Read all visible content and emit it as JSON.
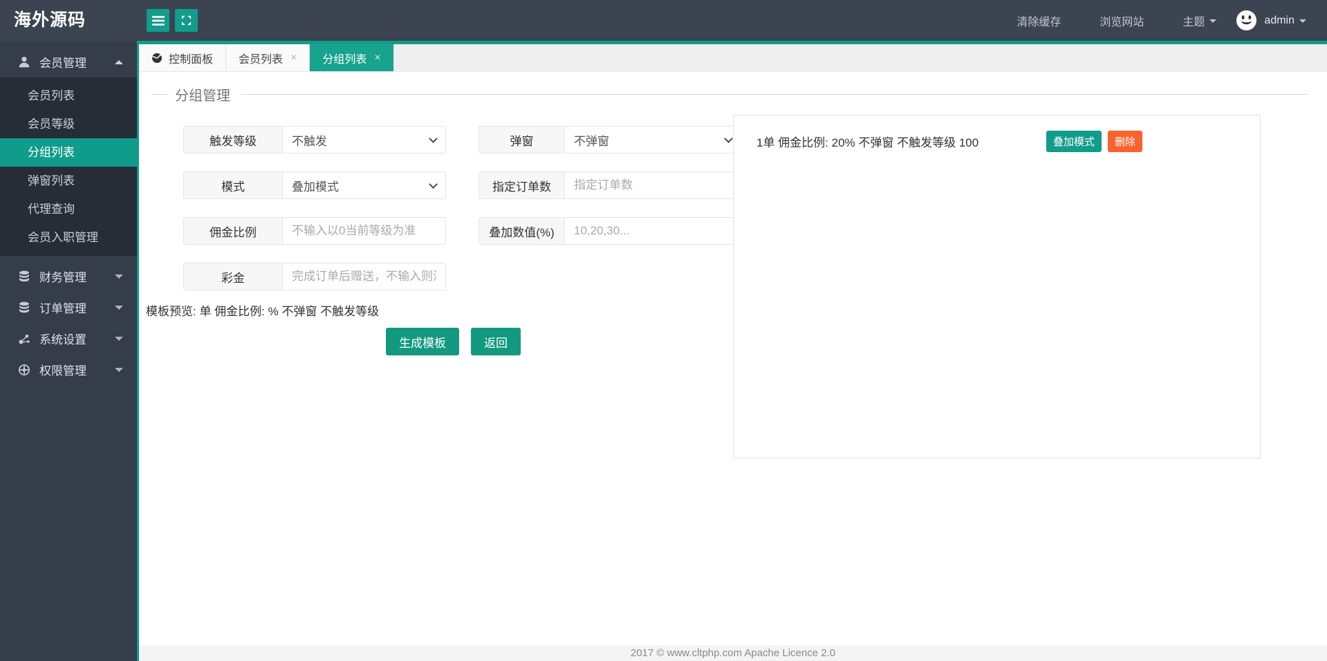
{
  "app": {
    "logo": "海外源码"
  },
  "header": {
    "clear_cache": "清除缓存",
    "browse_site": "浏览网站",
    "theme": "主题",
    "user": "admin"
  },
  "sidebar": {
    "groups": [
      {
        "label": "会员管理",
        "icon": "user-icon",
        "expanded": true,
        "children": [
          {
            "label": "会员列表"
          },
          {
            "label": "会员等级"
          },
          {
            "label": "分组列表",
            "active": true
          },
          {
            "label": "弹窗列表"
          },
          {
            "label": "代理查询"
          },
          {
            "label": "会员入职管理"
          }
        ]
      },
      {
        "label": "财务管理",
        "icon": "database-icon"
      },
      {
        "label": "订单管理",
        "icon": "database-icon"
      },
      {
        "label": "系统设置",
        "icon": "nodes-icon"
      },
      {
        "label": "权限管理",
        "icon": "globe-icon"
      }
    ]
  },
  "tabs": [
    {
      "label": "控制面板",
      "icon": "dashboard-icon",
      "closable": false
    },
    {
      "label": "会员列表",
      "closable": true,
      "close": "×"
    },
    {
      "label": "分组列表",
      "closable": true,
      "close": "×",
      "active": true
    }
  ],
  "main": {
    "section_title": "分组管理",
    "form": {
      "fields": [
        {
          "label": "触发等级",
          "type": "select",
          "value": "不触发"
        },
        {
          "label": "弹窗",
          "type": "select",
          "value": "不弹窗"
        },
        {
          "label": "模式",
          "type": "select",
          "value": "叠加模式"
        },
        {
          "label": "指定订单数",
          "type": "input",
          "placeholder": "指定订单数"
        },
        {
          "label": "佣金比例",
          "type": "input",
          "placeholder": "不输入以0当前等级为准"
        },
        {
          "label": "叠加数值(%)",
          "type": "input",
          "placeholder": "10,20,30..."
        },
        {
          "label": "彩金",
          "type": "input",
          "placeholder": "完成订单后赠送，不输入则没有"
        }
      ]
    },
    "preview": "模板预览: 单 佣金比例: % 不弹窗 不触发等级",
    "buttons": {
      "generate": "生成模板",
      "back": "返回"
    }
  },
  "panel": {
    "items": [
      {
        "text": "1单 佣金比例: 20% 不弹窗 不触发等级 100",
        "mode_label": "叠加模式",
        "delete_label": "删除"
      }
    ]
  },
  "footer": {
    "text": "2017 ©  www.cltphp.com  Apache Licence 2.0"
  },
  "colors": {
    "accent": "#129c8b",
    "tab_active": "#17a38e",
    "button": "#13997f",
    "delete_orange": "#f9622d",
    "header_bg": "#3b4450",
    "sidebar_bg": "#353d4a",
    "submenu_bg": "#272d37"
  }
}
